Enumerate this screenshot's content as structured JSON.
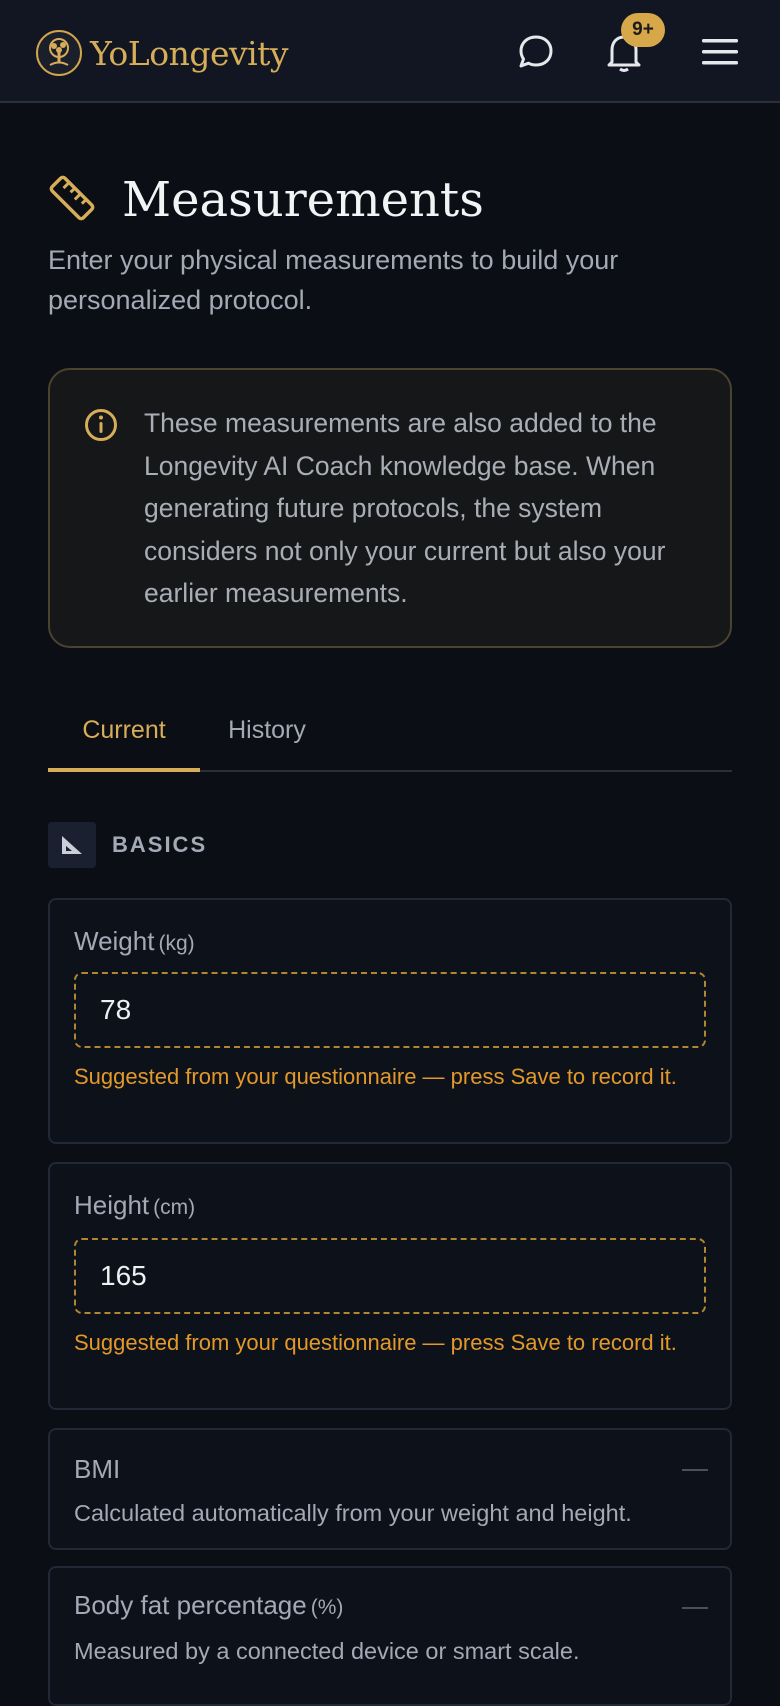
{
  "header": {
    "brand_name": "YoLongevity",
    "notification_badge": "9+",
    "icons": [
      "tree-logo-icon",
      "chat-icon",
      "bell-icon",
      "menu-icon"
    ]
  },
  "page": {
    "title": "Measurements",
    "subtitle": "Enter your physical measurements to build your personalized protocol.",
    "title_icon": "ruler-icon"
  },
  "info": {
    "icon": "info-icon",
    "text": "These measurements are also added to the Longevity AI Coach knowledge base. When generating future protocols, the system considers not only your current but also your earlier measurements."
  },
  "tabs": [
    {
      "label": "Current",
      "active": true
    },
    {
      "label": "History",
      "active": false
    }
  ],
  "section": {
    "title": "BASICS",
    "icon": "set-square-icon"
  },
  "fields": {
    "weight": {
      "label": "Weight",
      "unit": "(kg)",
      "value": "78",
      "hint": "Suggested from your questionnaire — press Save to record it."
    },
    "height": {
      "label": "Height",
      "unit": "(cm)",
      "value": "165",
      "hint": "Suggested from your questionnaire — press Save to record it."
    },
    "bmi": {
      "label": "BMI",
      "description": "Calculated automatically from your weight and height."
    },
    "body_fat": {
      "label": "Body fat percentage",
      "unit": "(%)",
      "description": "Measured by a connected device or smart scale."
    }
  },
  "colors": {
    "accent": "#d6ad58",
    "hint": "#e2982a",
    "background": "#0b0e14"
  }
}
